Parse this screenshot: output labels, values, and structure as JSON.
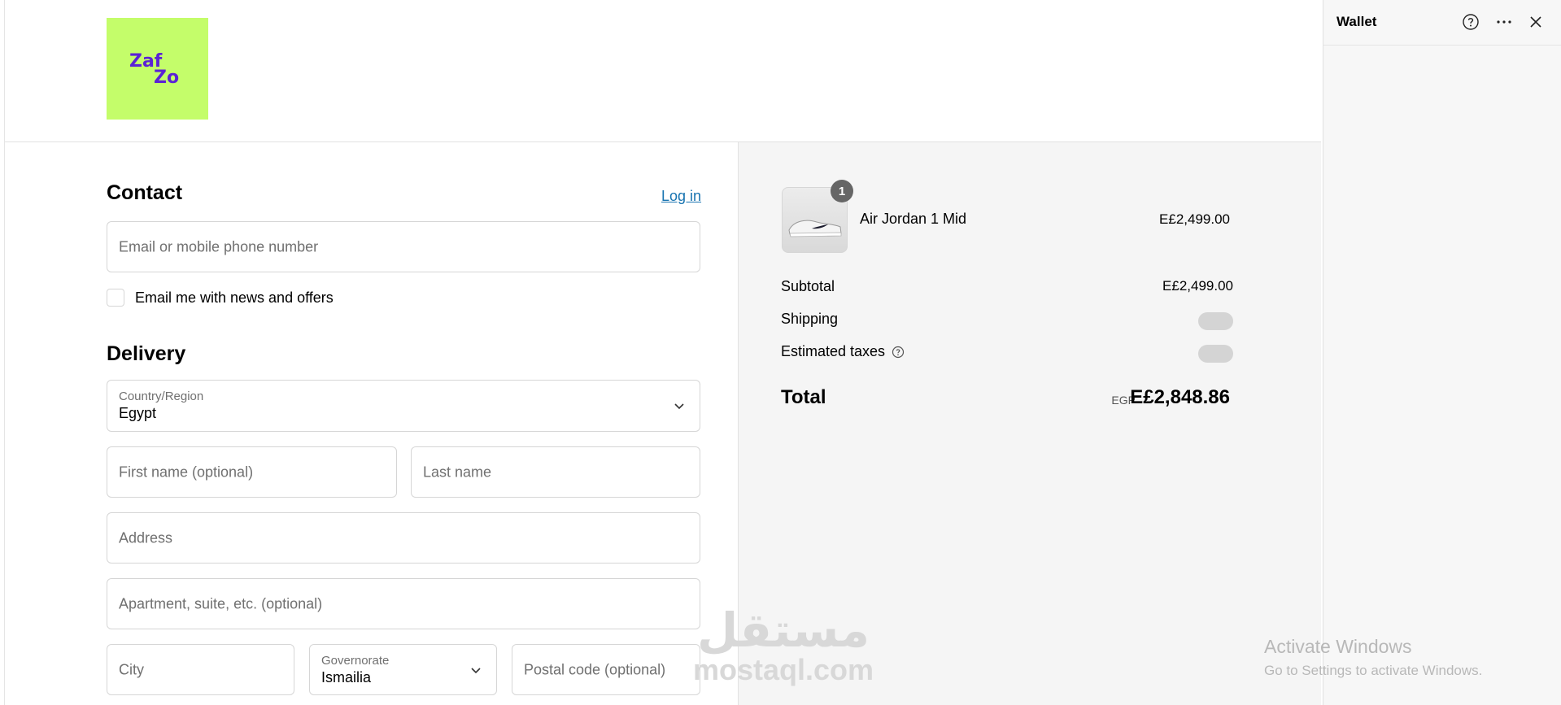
{
  "brand": {
    "logo_text_top": "Zaf",
    "logo_text_bottom": "Zo",
    "logo_bg": "#c4fd6a",
    "logo_fg": "#5b21d6"
  },
  "contact": {
    "title": "Contact",
    "login_label": "Log in",
    "email_placeholder": "Email or mobile phone number",
    "newsletter_label": "Email me with news and offers"
  },
  "delivery": {
    "title": "Delivery",
    "country_label": "Country/Region",
    "country_value": "Egypt",
    "first_name_placeholder": "First name (optional)",
    "last_name_placeholder": "Last name",
    "address_placeholder": "Address",
    "apartment_placeholder": "Apartment, suite, etc. (optional)",
    "city_placeholder": "City",
    "governorate_label": "Governorate",
    "governorate_value": "Ismailia",
    "postal_placeholder": "Postal code (optional)"
  },
  "summary": {
    "item": {
      "name": "Air Jordan 1 Mid",
      "price": "E£2,499.00",
      "quantity": "1"
    },
    "subtotal_label": "Subtotal",
    "subtotal_value": "E£2,499.00",
    "shipping_label": "Shipping",
    "taxes_label": "Estimated taxes",
    "total_label": "Total",
    "total_currency": "EGP",
    "total_value": "E£2,848.86"
  },
  "wallet": {
    "title": "Wallet",
    "icons": [
      "help-icon",
      "more-icon",
      "close-icon"
    ]
  },
  "watermark": {
    "arabic": "مستقل",
    "latin": "mostaql.com"
  },
  "os_notice": {
    "line1": "Activate Windows",
    "line2": "Go to Settings to activate Windows."
  },
  "colors": {
    "link": "#1773b0",
    "panel_bg": "#f5f5f5",
    "badge": "#666666"
  }
}
